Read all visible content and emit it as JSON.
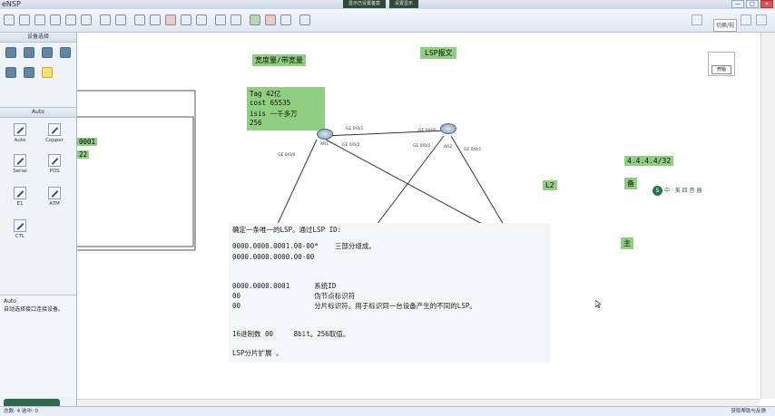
{
  "app": {
    "title": "eNSP",
    "center_tabs": [
      "显示已设置备案",
      "设置显示"
    ],
    "window_buttons": [
      "—",
      "□",
      "×"
    ],
    "float_button": "切换/视图"
  },
  "left_panel": {
    "device_header": "设备选择",
    "cable_header": "Auto",
    "cables": [
      "Auto",
      "Copper",
      "Serial",
      "POS",
      "E1",
      "ATM",
      "CTL"
    ],
    "desc_title": "Auto",
    "desc_text": "自动选择接口连接设备。"
  },
  "canvas": {
    "rect_labels": [
      "0001",
      "22"
    ],
    "title_bandwidth": "宽度量/带宽量",
    "title_lsp": "LSP报文",
    "info_box": {
      "line1": "Tag   42亿",
      "line2": "cost  65535",
      "line3": "isis  一千多万",
      "line4": "256"
    },
    "routers": [
      {
        "name": "AR1"
      },
      {
        "name": "AR2"
      }
    ],
    "port_labels": {
      "ar1_a": "GE 0/0/1",
      "ar1_b": "GE 0/0/2",
      "ar1_c": "GE 0/0/0",
      "ar2_a": "GE 0/0/0",
      "ar2_b": "GE 0/0/2",
      "ar2_c": "GE 0/0/1"
    },
    "ip_label": "4.4.4.4/32",
    "l2_label": "L2",
    "bei_label": "备",
    "zhu_label": "主",
    "logo_text": "中 · 美 四 音 器",
    "start_box_button": "开始",
    "note": {
      "line1": "确定一条唯一的LSP。通过LSP ID:",
      "line2": "0000.0000.0001.00-00*    三部分组成。",
      "line3": "0000.0000.0000.00-00",
      "line4": "0000.0000.0001      系统ID",
      "line5": "00                  伪节点标识符",
      "line6": "00                  分片标识符。用于标识同一台设备产生的不同的LSP。",
      "line7": "16进制数 00     8bit。256取值。",
      "line8": "LSP分片扩展 。"
    }
  },
  "status": {
    "left": "总数: 4  选中: 0",
    "right": "获取帮助与反馈"
  },
  "colors": {
    "green_label": "#8fcf7f",
    "note_bg": "#f4f6f8",
    "tab_bg": "#2f4a3a"
  }
}
